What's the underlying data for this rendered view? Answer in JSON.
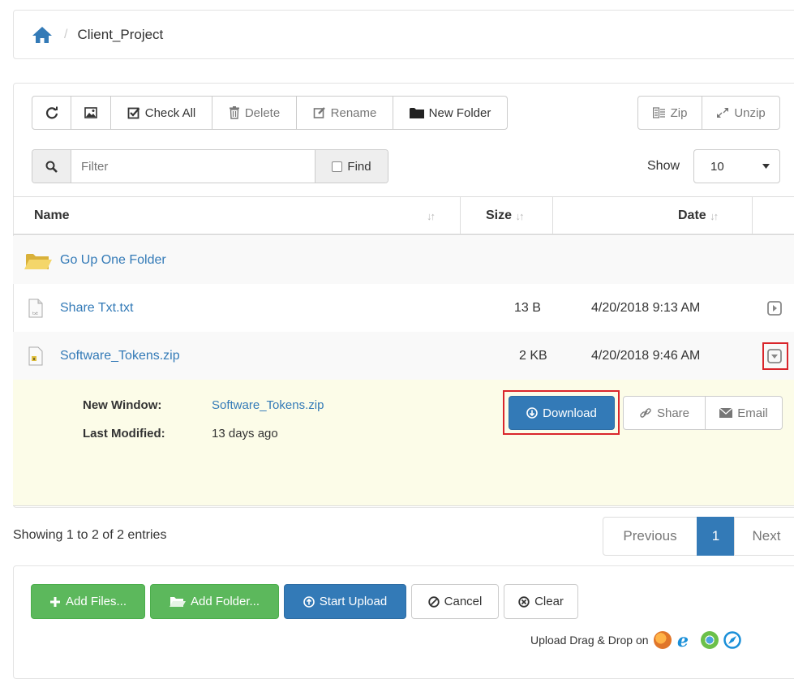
{
  "breadcrumb": {
    "current": "Client_Project",
    "separator": "/"
  },
  "toolbar": {
    "check_all": "Check All",
    "delete": "Delete",
    "rename": "Rename",
    "new_folder": "New Folder",
    "zip": "Zip",
    "unzip": "Unzip"
  },
  "filter": {
    "placeholder": "Filter",
    "find": "Find"
  },
  "show": {
    "label": "Show",
    "value": "10"
  },
  "table": {
    "headers": {
      "name": "Name",
      "size": "Size",
      "date": "Date"
    },
    "go_up": "Go Up One Folder",
    "rows": [
      {
        "name": "Share Txt.txt",
        "size": "13 B",
        "date": "4/20/2018 9:13 AM"
      },
      {
        "name": "Software_Tokens.zip",
        "size": "2 KB",
        "date": "4/20/2018 9:46 AM"
      }
    ]
  },
  "detail": {
    "new_window_label": "New Window:",
    "new_window_value": "Software_Tokens.zip",
    "last_modified_label": "Last Modified:",
    "last_modified_value": "13 days ago",
    "download": "Download",
    "share": "Share",
    "email": "Email"
  },
  "footer": {
    "info": "Showing 1 to 2 of 2 entries",
    "previous": "Previous",
    "page": "1",
    "next": "Next"
  },
  "upload": {
    "add_files": "Add Files...",
    "add_folder": "Add Folder...",
    "start_upload": "Start Upload",
    "cancel": "Cancel",
    "clear": "Clear",
    "drag_drop": "Upload Drag & Drop on"
  },
  "colors": {
    "link": "#337ab7",
    "primary": "#337ab7",
    "success": "#5cb85c",
    "highlight_row": "#fcfce8",
    "annotation_red": "#d9252b"
  }
}
